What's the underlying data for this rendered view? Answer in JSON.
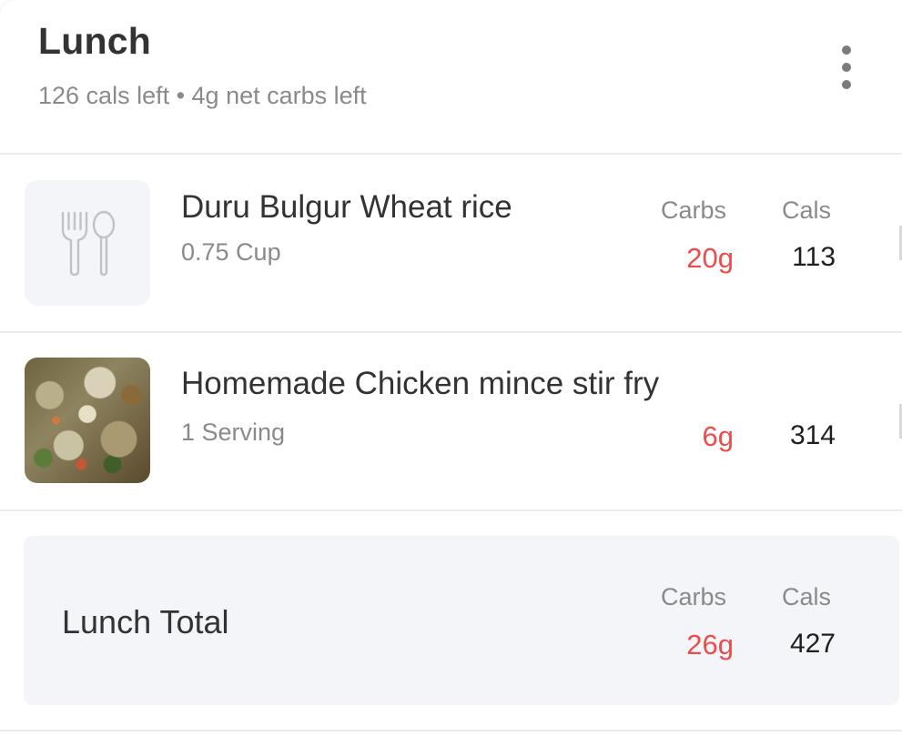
{
  "meal": {
    "title": "Lunch",
    "subtitle": "126 cals left • 4g net carbs left",
    "more_icon": "more-vertical-icon"
  },
  "items": [
    {
      "name": "Duru Bulgur Wheat rice",
      "portion": "0.75 Cup",
      "carbs_label": "Carbs",
      "cals_label": "Cals",
      "carbs": "20g",
      "cals": "113",
      "image": "fork-spoon-icon"
    },
    {
      "name": "Homemade Chicken mince stir fry",
      "portion": "1 Serving",
      "carbs": "6g",
      "cals": "314",
      "image": "food-photo"
    }
  ],
  "total": {
    "label": "Lunch Total",
    "carbs_label": "Carbs",
    "cals_label": "Cals",
    "carbs": "26g",
    "cals": "427"
  },
  "colors": {
    "carbs": "#ee4b4b",
    "text": "#333333",
    "muted": "#8a8a8a",
    "panel": "#f4f5f8"
  }
}
